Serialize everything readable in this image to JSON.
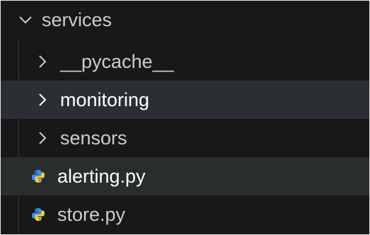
{
  "explorer": {
    "root": {
      "label": "services",
      "icon": "chevron-down-icon"
    },
    "items": [
      {
        "label": "__pycache__",
        "kind": "folder",
        "icon": "chevron-right-icon",
        "state": "collapsed"
      },
      {
        "label": "monitoring",
        "kind": "folder",
        "icon": "chevron-right-icon",
        "state": "collapsed"
      },
      {
        "label": "sensors",
        "kind": "folder",
        "icon": "chevron-right-icon",
        "state": "collapsed"
      },
      {
        "label": "alerting.py",
        "kind": "file",
        "icon": "python-file-icon"
      },
      {
        "label": "store.py",
        "kind": "file",
        "icon": "python-file-icon"
      }
    ]
  },
  "colors": {
    "background": "#181818",
    "text": "#cccccc",
    "text_highlight": "#ffffff",
    "hover_row": "#2a2d2e",
    "python_blue": "#3b8eea",
    "python_yellow": "#f2c94c"
  }
}
